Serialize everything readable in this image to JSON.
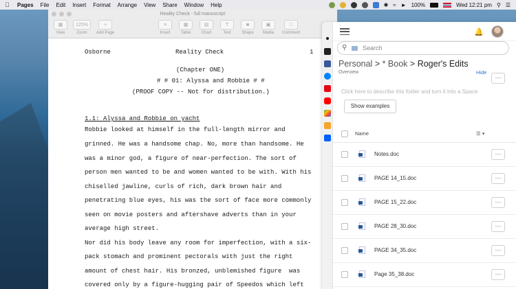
{
  "menubar": {
    "app": "Pages",
    "menus": [
      "File",
      "Edit",
      "Insert",
      "Format",
      "Arrange",
      "View",
      "Share",
      "Window",
      "Help"
    ],
    "battery": "100%",
    "clock": "Wed 12:21 pm"
  },
  "pages_window": {
    "title": "Reality Check - full manuscript",
    "toolbar": {
      "view": "View",
      "zoom_value": "125%",
      "zoom": "Zoom",
      "add_page": "Add Page",
      "insert": "Insert",
      "table": "Table",
      "chart": "Chart",
      "text": "Text",
      "shape": "Shape",
      "media": "Media",
      "comment": "Comment"
    },
    "document": {
      "header_left": "Osborne",
      "header_center": "Reality Check",
      "header_page": "1",
      "chapter": "(Chapter ONE)",
      "section_title": "# # 01: Alyssa and Robbie # #",
      "proof": "(PROOF COPY -- Not for distribution.)",
      "scene": "1.1: Alyssa and Robbie on yacht",
      "lines": [
        "Robbie looked at himself in the full-length mirror and",
        "grinned. He was a handsome chap. No, more than handsome. He",
        "was a minor god, a figure of near-perfection. The sort of",
        "person men wanted to be and women wanted to be with. With his",
        "chiselled jawline, curls of rich, dark brown hair and",
        "penetrating blue eyes, his was the sort of face more commonly",
        "seen on movie posters and aftershave adverts than in your",
        "average high street.",
        "Nor did his body leave any room for imperfection, with a six-",
        "pack stomach and prominent pectorals with just the right",
        "amount of chest hair. His bronzed, unblemished figure  was",
        "covered only by a figure-hugging pair of Speedos which left"
      ]
    }
  },
  "dropbox": {
    "search_placeholder": "Search",
    "breadcrumb": {
      "root": "Personal",
      "sep": " > ",
      "middle": "* Book",
      "current": "Roger's Edits"
    },
    "overview": "Overview",
    "hide": "Hide",
    "more": "···",
    "description_placeholder": "Click here to describe this folder and turn it into a Space",
    "show_examples": "Show examples",
    "column_name": "Name",
    "column_view": "☰ ▾",
    "files": [
      "Notes.doc",
      "PAGE 14_15.doc",
      "PAGE 15_22.doc",
      "PAGE 28_30.doc",
      "PAGE 34_35.doc",
      "Page 35_38.doc"
    ]
  }
}
